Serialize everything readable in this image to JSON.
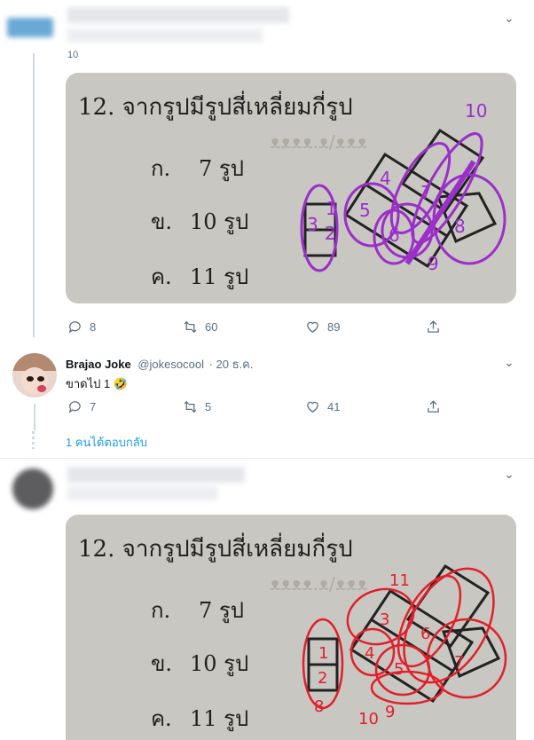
{
  "tweet1": {
    "reply_count_partial": "10",
    "image": {
      "question": "12. จากรูปมีรูปสี่เหลี่ยมกี่รูป",
      "options": [
        {
          "label": "ก.",
          "value": "7 รูป"
        },
        {
          "label": "ข.",
          "value": "10 รูป"
        },
        {
          "label": "ค.",
          "value": "11 รูป"
        }
      ],
      "annotations": [
        "10",
        "1",
        "2",
        "3",
        "4",
        "5",
        "6",
        "7",
        "8",
        "9"
      ],
      "annotation_color": "#9b2fc9"
    },
    "actions": {
      "replies": "8",
      "retweets": "60",
      "likes": "89"
    }
  },
  "tweet2": {
    "display_name": "Brajao Joke",
    "handle": "@jokesocool",
    "date": "· 20 ธ.ค.",
    "text": "ขาดไป 1 🤣",
    "actions": {
      "replies": "7",
      "retweets": "5",
      "likes": "41"
    },
    "thread_link": "1 คนได้ตอบกลับ"
  },
  "tweet3": {
    "image": {
      "question": "12. จากรูปมีรูปสี่เหลี่ยมกี่รูป",
      "options": [
        {
          "label": "ก.",
          "value": "7 รูป"
        },
        {
          "label": "ข.",
          "value": "10 รูป"
        },
        {
          "label": "ค.",
          "value": "11 รูป"
        }
      ],
      "annotations": [
        "11",
        "1",
        "2",
        "3",
        "4",
        "5",
        "6",
        "7",
        "8",
        "9",
        "10"
      ],
      "annotation_color": "#e0202a"
    }
  },
  "colors": {
    "text": "#0f1419",
    "muted": "#5b7083",
    "link": "#1d9bf0",
    "divider": "#e6ecf0"
  }
}
